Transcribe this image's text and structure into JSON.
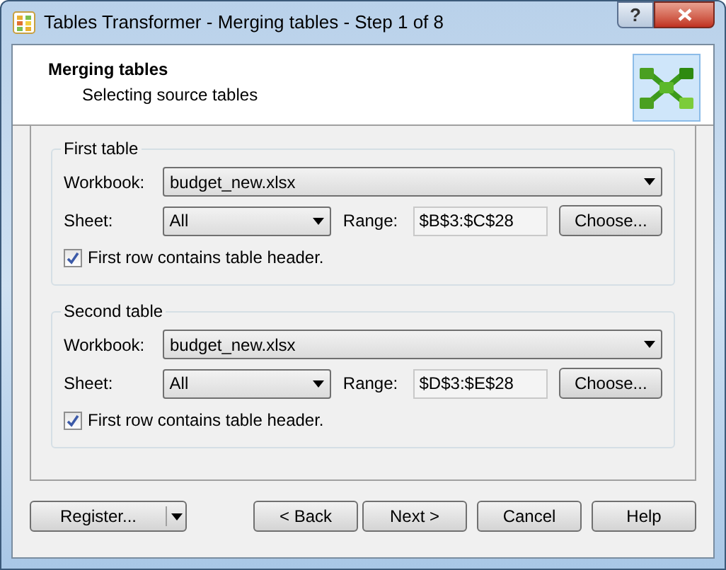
{
  "window": {
    "title": "Tables Transformer - Merging tables - Step 1 of 8",
    "help_button": "?"
  },
  "header": {
    "title": "Merging tables",
    "subtitle": "Selecting source tables"
  },
  "tables": [
    {
      "heading": "First table",
      "workbook_label": "Workbook:",
      "workbook": "budget_new.xlsx",
      "sheet_label": "Sheet:",
      "sheet": "All",
      "range_label": "Range:",
      "range": "$B$3:$C$28",
      "choose_button": "Choose...",
      "header_checkbox": {
        "label": "First row contains table header.",
        "checked": true
      }
    },
    {
      "heading": "Second table",
      "workbook_label": "Workbook:",
      "workbook": "budget_new.xlsx",
      "sheet_label": "Sheet:",
      "sheet": "All",
      "range_label": "Range:",
      "range": "$D$3:$E$28",
      "choose_button": "Choose...",
      "header_checkbox": {
        "label": "First row contains table header.",
        "checked": true
      }
    }
  ],
  "buttons": {
    "register": "Register...",
    "back": "< Back",
    "next": "Next >",
    "cancel": "Cancel",
    "help": "Help"
  }
}
